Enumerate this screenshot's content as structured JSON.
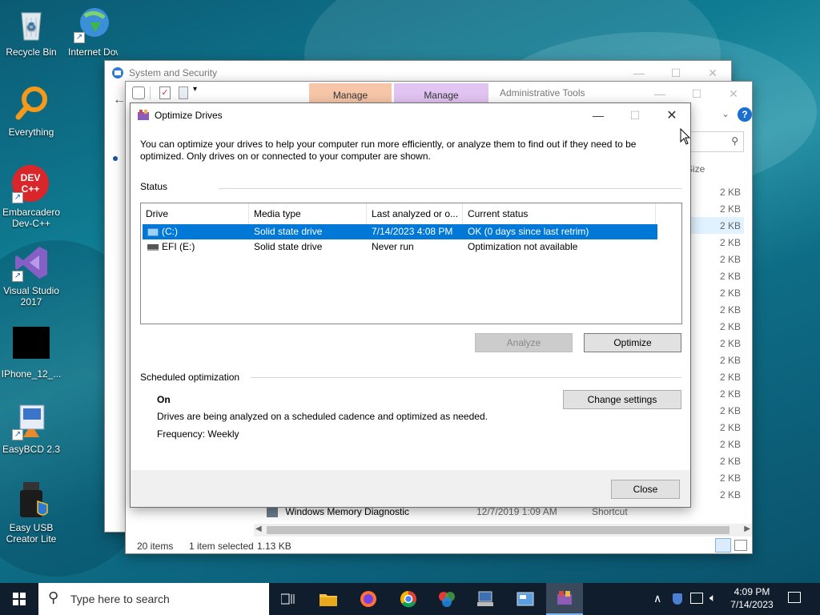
{
  "desktop": {
    "icons": [
      {
        "label": "Recycle Bin"
      },
      {
        "label": "Internet Downlo..."
      },
      {
        "label": "Everything"
      },
      {
        "label": "Embarcadero Dev-C++"
      },
      {
        "label": "Visual Studio 2017"
      },
      {
        "label": "IPhone_12_..."
      },
      {
        "label": "EasyBCD 2.3"
      },
      {
        "label": "Easy USB Creator Lite"
      }
    ],
    "dev_icon_text": "DEV C++"
  },
  "back_window": {
    "title": "System and Security"
  },
  "explorer": {
    "ribbon_tab_1": "Manage",
    "ribbon_tab_2": "Manage",
    "title": "Administrative Tools",
    "size_header": "Size",
    "sizes": [
      "2 KB",
      "2 KB",
      "2 KB",
      "2 KB",
      "2 KB",
      "2 KB",
      "2 KB",
      "2 KB",
      "2 KB",
      "2 KB",
      "2 KB",
      "2 KB",
      "2 KB",
      "2 KB",
      "2 KB",
      "2 KB",
      "2 KB",
      "2 KB",
      "2 KB"
    ],
    "visible_row": {
      "name": "Windows Memory Diagnostic",
      "date": "12/7/2019 1:09 AM",
      "type": "Shortcut"
    },
    "status_items": "20 items",
    "status_selected": "1 item selected",
    "status_size": "1.13 KB"
  },
  "dialog": {
    "title": "Optimize Drives",
    "intro": "You can optimize your drives to help your computer run more efficiently, or analyze them to find out if they need to be optimized. Only drives on or connected to your computer are shown.",
    "status_label": "Status",
    "columns": [
      "Drive",
      "Media type",
      "Last analyzed or o...",
      "Current status"
    ],
    "drives": [
      {
        "drive": "(C:)",
        "media": "Solid state drive",
        "last": "7/14/2023 4:08 PM",
        "status": "OK (0 days since last retrim)"
      },
      {
        "drive": "EFI (E:)",
        "media": "Solid state drive",
        "last": "Never run",
        "status": "Optimization not available"
      }
    ],
    "analyze_label": "Analyze",
    "optimize_label": "Optimize",
    "scheduled_label": "Scheduled optimization",
    "schedule_state": "On",
    "schedule_desc": "Drives are being analyzed on a scheduled cadence and optimized as needed.",
    "frequency": "Frequency: Weekly",
    "change_settings_label": "Change settings",
    "close_label": "Close"
  },
  "taskbar": {
    "search_placeholder": "Type here to search",
    "time": "4:09 PM",
    "date": "7/14/2023"
  },
  "colors": {
    "selection": "#0078d7",
    "manage_tab_1": "#f7c6a8",
    "manage_tab_2": "#e2c4f2",
    "taskbar": "#0f1d2c"
  }
}
